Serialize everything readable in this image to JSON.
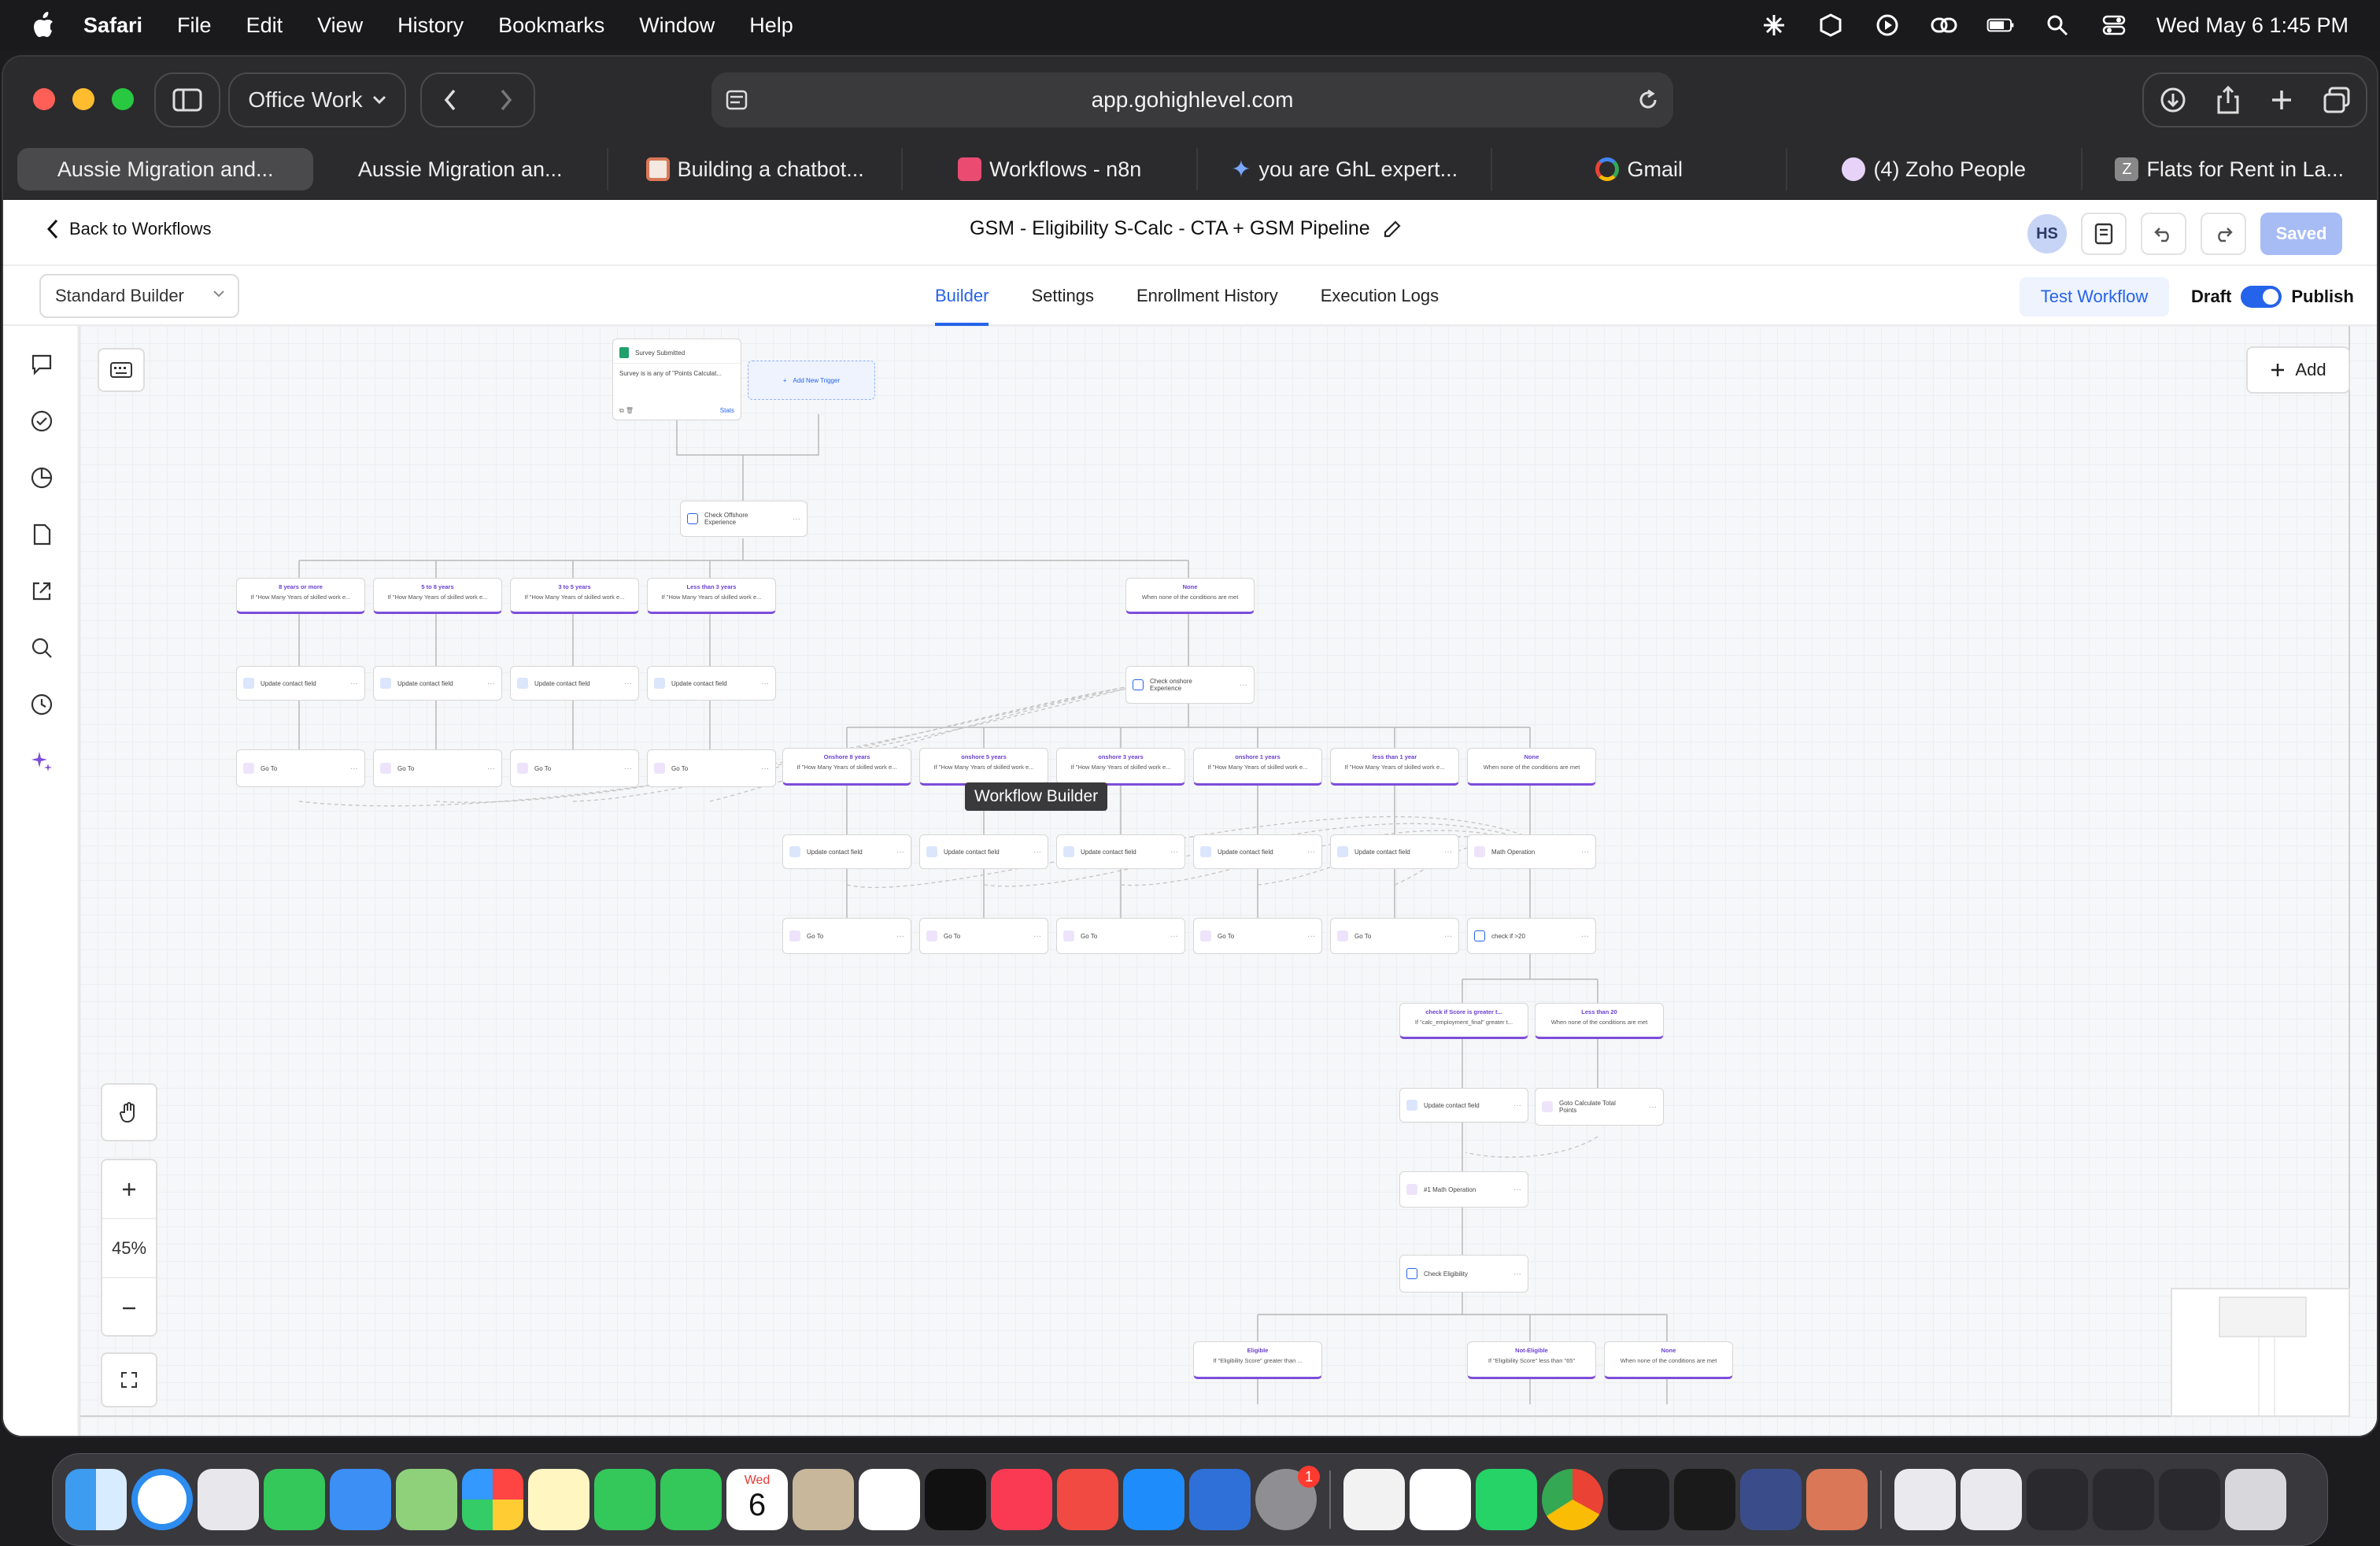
{
  "menubar": {
    "app": "Safari",
    "items": [
      "File",
      "Edit",
      "View",
      "History",
      "Bookmarks",
      "Window",
      "Help"
    ],
    "datetime": "Wed May 6  1:45 PM"
  },
  "browser": {
    "profile": "Office Work",
    "url": "app.gohighlevel.com",
    "tabs": [
      {
        "label": "Aussie Migration and...",
        "active": true
      },
      {
        "label": "Aussie Migration an...",
        "active": false
      },
      {
        "label": "Building a chatbot...",
        "active": false
      },
      {
        "label": "Workflows - n8n",
        "active": false
      },
      {
        "label": "you are GhL expert...",
        "active": false
      },
      {
        "label": "Gmail",
        "active": false
      },
      {
        "label": "(4) Zoho People",
        "active": false
      },
      {
        "label": "Flats for Rent in La...",
        "active": false
      }
    ]
  },
  "header": {
    "back_label": "Back to Workflows",
    "title": "GSM - Eligibility S-Calc - CTA + GSM Pipeline",
    "avatar": "HS",
    "saved_label": "Saved"
  },
  "subheader": {
    "builder_select": "Standard Builder",
    "tabs": [
      "Builder",
      "Settings",
      "Enrollment History",
      "Execution Logs"
    ],
    "active_tab": "Builder",
    "test_label": "Test Workflow",
    "draft_label": "Draft",
    "publish_label": "Publish",
    "published": true
  },
  "canvas": {
    "add_label": "Add",
    "zoom": "45%",
    "tooltip": "Workflow Builder",
    "trigger": {
      "title": "Survey Submitted",
      "desc": "Survey is is any of \"Points Calculat...",
      "stats": "Stats"
    },
    "add_trigger": "Add New Trigger",
    "check_offshore": "Check Offshore Experience",
    "offshore_branches": [
      {
        "title": "8 years or more",
        "desc": "If \"How Many Years of skilled work e..."
      },
      {
        "title": "5 to 8 years",
        "desc": "If \"How Many Years of skilled work e..."
      },
      {
        "title": "3 to 5 years",
        "desc": "If \"How Many Years of skilled work e..."
      },
      {
        "title": "Less than 3 years",
        "desc": "If \"How Many Years of skilled work e..."
      },
      {
        "title": "None",
        "desc": "When none of the conditions are met"
      }
    ],
    "update_field": "Update contact field",
    "go_to": "Go To",
    "check_onshore": "Check onshore Experience",
    "onshore_branches": [
      {
        "title": "Onshore 8 years",
        "desc": "If \"How Many Years of skilled work e..."
      },
      {
        "title": "onshore 5 years",
        "desc": "If \"How Many Years of skilled work e..."
      },
      {
        "title": "onshore 3 years",
        "desc": "If \"How Many Years of skilled work e..."
      },
      {
        "title": "onshore 1 years",
        "desc": "If \"How Many Years of skilled work e..."
      },
      {
        "title": "less than 1 year",
        "desc": "If \"How Many Years of skilled work e..."
      },
      {
        "title": "None",
        "desc": "When none of the conditions are met"
      }
    ],
    "math_operation": "Math Operation",
    "check_20": "check if >20",
    "score_branches": [
      {
        "title": "check if Score is greater t...",
        "desc": "If \"calc_employment_final\" greater t..."
      },
      {
        "title": "Less than 20",
        "desc": "When none of the conditions are met"
      }
    ],
    "goto_calc": "Goto Calculate Total Points",
    "math_operation_1": "#1 Math Operation",
    "check_eligibility": "Check Eligibility",
    "eligibility_branches": [
      {
        "title": "Eligible",
        "desc": "If \"Eligibility Score\" greater than ..."
      },
      {
        "title": "Not-Eligible",
        "desc": "If \"Eligibility Score\" less than \"65\""
      },
      {
        "title": "None",
        "desc": "When none of the conditions are met"
      }
    ]
  },
  "dock": {
    "calendar_month": "Wed",
    "calendar_day": "6",
    "settings_badge": "1"
  },
  "colors": {
    "accent": "#2563eb",
    "branch_purple": "#7c4ddb",
    "saved_bg": "#a7bcf5"
  }
}
